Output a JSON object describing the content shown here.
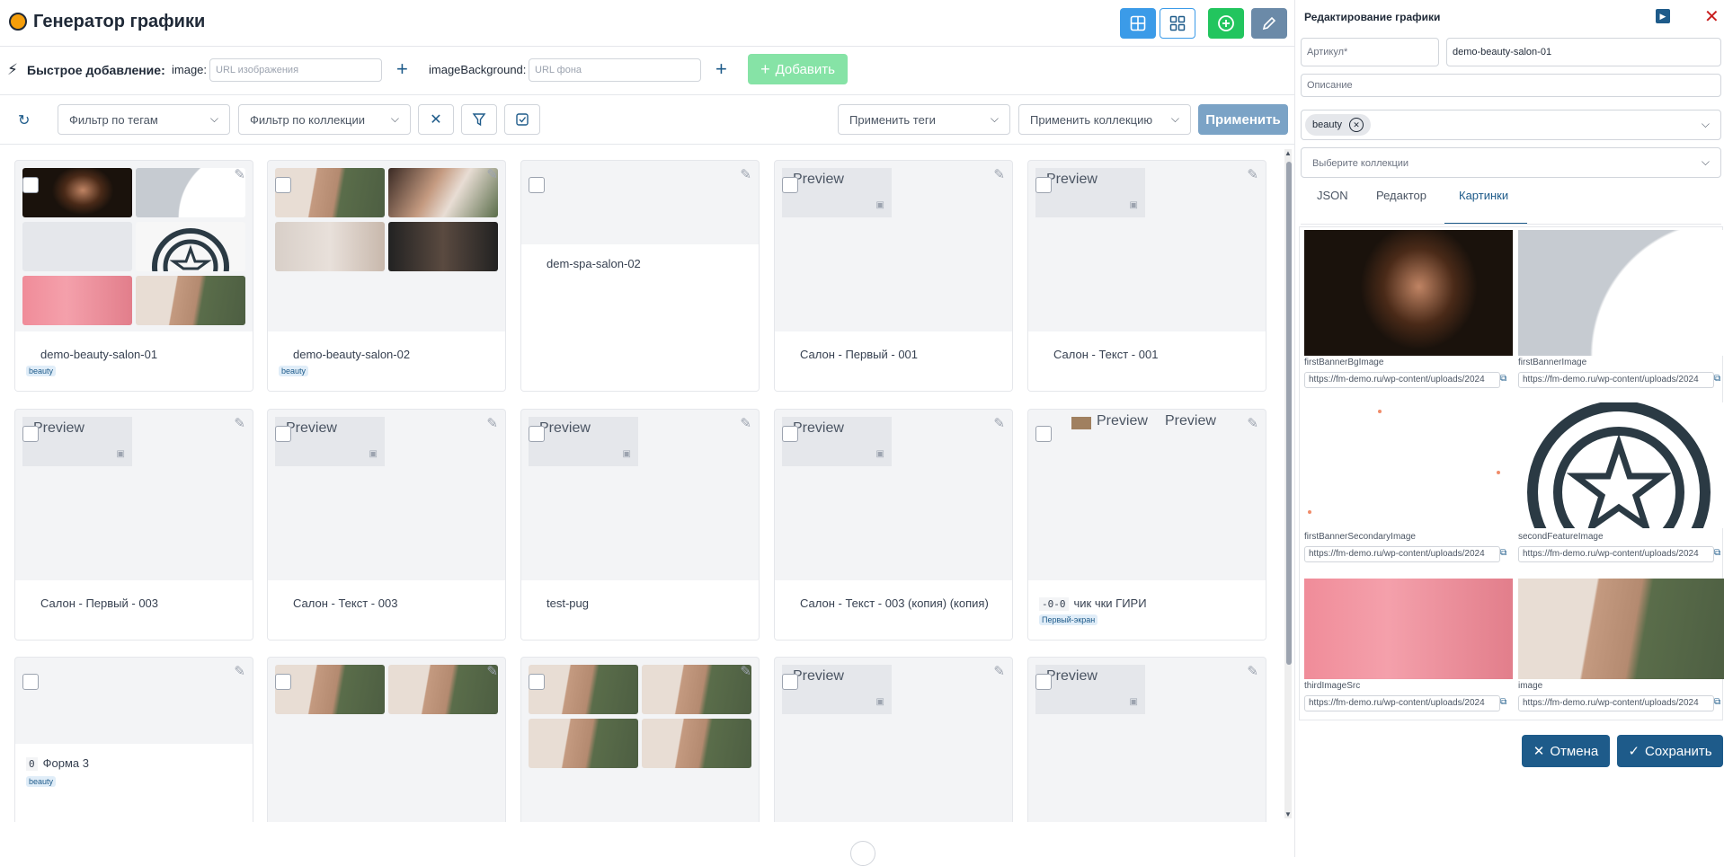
{
  "header": {
    "title": "Генератор графики"
  },
  "quick_add": {
    "label": "Быстрое добавление:",
    "image_label": "image:",
    "image_placeholder": "URL изображения",
    "bg_label": "imageBackground:",
    "bg_placeholder": "URL фона",
    "add_label": "Добавить"
  },
  "filters": {
    "tags_placeholder": "Фильтр по тегам",
    "collection_placeholder": "Фильтр по коллекции",
    "apply_tags": "Применить теги",
    "apply_collection": "Применить коллекцию",
    "apply_label": "Применить"
  },
  "cards": [
    {
      "name": "demo-beauty-salon-01",
      "tag": "beauty"
    },
    {
      "name": "demo-beauty-salon-02",
      "tag": "beauty"
    },
    {
      "name": "dem-spa-salon-02"
    },
    {
      "name": "Салон - Первый - 001"
    },
    {
      "name": "Салон - Текст - 001"
    },
    {
      "name": "Салон - Первый - 003"
    },
    {
      "name": "Салон - Текст - 003"
    },
    {
      "name": "test-pug"
    },
    {
      "name": "Салон - Текст - 003 (копия) (копия)"
    },
    {
      "code": "-0-0",
      "name": "чик чки ГИРИ",
      "tag": "Первый-экран"
    },
    {
      "code": "0",
      "name": "Форма 3",
      "tag": "beauty"
    }
  ],
  "preview_text": "Preview",
  "panel": {
    "title": "Редактирование графики",
    "article_placeholder": "Артикул*",
    "article_value": "demo-beauty-salon-01",
    "description_placeholder": "Описание",
    "tag_chip": "beauty",
    "collections_placeholder": "Выберите коллекции",
    "tabs": [
      "JSON",
      "Редактор",
      "Картинки"
    ],
    "active_tab": "Картинки",
    "images": [
      {
        "label": "firstBannerBgImage",
        "url": "https://fm-demo.ru/wp-content/uploads/2024"
      },
      {
        "label": "firstBannerImage",
        "url": "https://fm-demo.ru/wp-content/uploads/2024"
      },
      {
        "label": "firstBannerSecondaryImage",
        "url": "https://fm-demo.ru/wp-content/uploads/2024"
      },
      {
        "label": "secondFeatureImage",
        "url": "https://fm-demo.ru/wp-content/uploads/2024"
      },
      {
        "label": "thirdImageSrc",
        "url": "https://fm-demo.ru/wp-content/uploads/2024"
      },
      {
        "label": "image",
        "url": "https://fm-demo.ru/wp-content/uploads/2024"
      }
    ],
    "cancel_label": "Отмена",
    "save_label": "Сохранить"
  },
  "colors": {
    "primary": "#1e5b8a",
    "accent_blue": "#3b9be8",
    "green": "#22c55e",
    "disabled_green": "#86e3a6",
    "apply_disabled": "#7ba3c6"
  }
}
